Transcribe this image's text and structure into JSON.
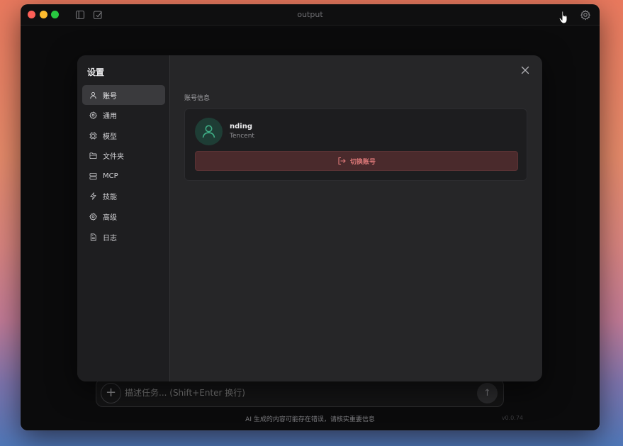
{
  "window": {
    "title": "output"
  },
  "composer": {
    "placeholder": "描述任务... (Shift+Enter 换行)",
    "plus_label": "+",
    "send_label": "↑"
  },
  "footer": {
    "disclaimer": "AI 生成的内容可能存在错误，请核实重要信息",
    "version": "v0.0.74"
  },
  "settings": {
    "title": "设置",
    "nav": [
      {
        "label": "账号",
        "icon": "user-icon",
        "active": true
      },
      {
        "label": "通用",
        "icon": "gear-icon"
      },
      {
        "label": "模型",
        "icon": "chip-icon"
      },
      {
        "label": "文件夹",
        "icon": "folder-icon"
      },
      {
        "label": "MCP",
        "icon": "server-icon"
      },
      {
        "label": "技能",
        "icon": "bolt-icon"
      },
      {
        "label": "高级",
        "icon": "gear-advanced-icon"
      },
      {
        "label": "日志",
        "icon": "document-icon"
      }
    ],
    "account": {
      "section_label": "账号信息",
      "user_name": "nding",
      "org": "Tencent",
      "switch_label": "切换账号"
    }
  },
  "colors": {
    "accent_green": "#3fae86",
    "danger_text": "#e07a7a",
    "danger_bg": "#4a2a2c"
  }
}
